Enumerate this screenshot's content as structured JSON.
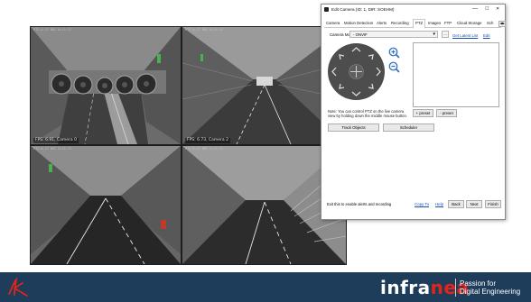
{
  "cameras": [
    {
      "stamp": "PTZ 0-17 REC 0:11:17",
      "label": "FPS: 6.91, Camera 0"
    },
    {
      "stamp": "PTZ 0-17 REC 0:11:17",
      "label": "FPS: 6.73, Camera 2"
    },
    {
      "stamp": "PTZ 0-17 REC 0:11:17",
      "label": ""
    },
    {
      "stamp": "PTZ 0-17 REC 0:11:17",
      "label": ""
    }
  ],
  "dialog": {
    "title": "Edit Camera (ID: 1, DIR: SOEHM)",
    "window_buttons": {
      "minimize": "—",
      "maximize": "☐",
      "close": "✕"
    },
    "tabs": [
      "Camera",
      "Motion Detection",
      "Alerts",
      "Recording",
      "PTZ",
      "Images",
      "FTP",
      "Cloud Storage",
      "Sch"
    ],
    "active_tab": "PTZ",
    "camera_model_label": "Camera Model",
    "camera_model_value": "- ONVIF",
    "more_button": "...",
    "get_latest_list": "Get Latest List",
    "edit_link": "Edit",
    "note": "Note: You can control PTZ on the live camera view by holding down the middle mouse button.",
    "plus_preset": "+ preset",
    "minus_preset": "- preset",
    "track_objects": "Track Objects",
    "scheduler": "Scheduler",
    "footer_text": "Exit this to enable alerts and recording",
    "copy_to": "Copy To",
    "help": "Help",
    "back": "Back",
    "next": "Next",
    "finish": "Finish"
  },
  "brand": {
    "word_part1": "infra",
    "word_part2": "nea",
    "tagline_1": "Passion for",
    "tagline_2": "Digital Engineering",
    "accent_color": "#e1251b",
    "bar_color": "#1e3d5b"
  }
}
